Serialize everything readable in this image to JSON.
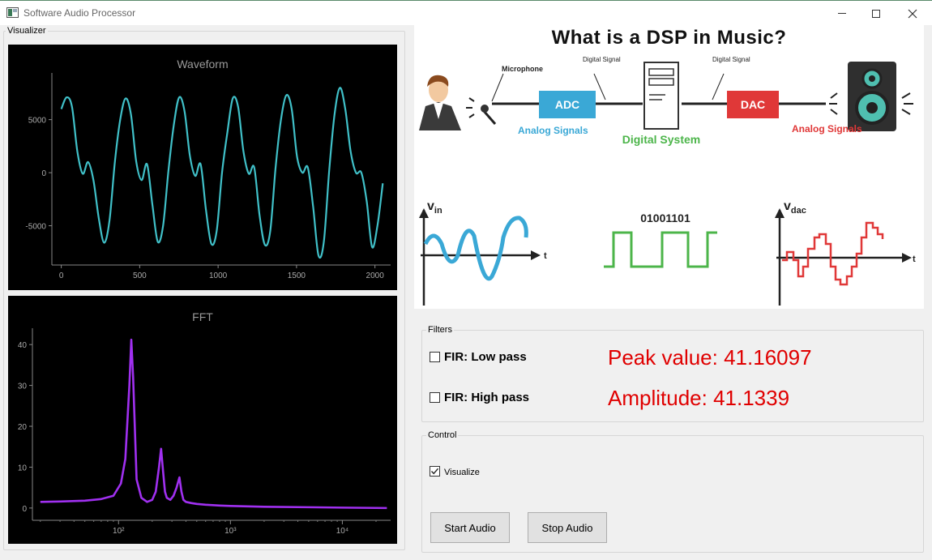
{
  "window": {
    "title": "Software Audio Processor",
    "minimize_icon": "minimize-icon",
    "maximize_icon": "maximize-icon",
    "close_icon": "close-icon"
  },
  "visualizer": {
    "title": "Visualizer",
    "waveform": {
      "title": "Waveform",
      "y_ticks": [
        "5000",
        "0",
        "-5000"
      ],
      "x_ticks": [
        "0",
        "500",
        "1000",
        "1500",
        "2000"
      ],
      "line_color": "#40c0c8"
    },
    "fft": {
      "title": "FFT",
      "y_ticks": [
        "40",
        "30",
        "20",
        "10",
        "0"
      ],
      "x_ticks": [
        "10²",
        "10³",
        "10⁴"
      ],
      "line_color": "#a030f0"
    }
  },
  "dsp_image": {
    "heading": "What is a DSP in Music?",
    "labels": {
      "microphone": "Microphone",
      "digital_signal_1": "Digital Signal",
      "digital_signal_2": "Digital Signal",
      "adc": "ADC",
      "dac": "DAC",
      "analog_signals_1": "Analog Signals",
      "analog_signals_2": "Analog Signals",
      "digital_system": "Digital System",
      "vin": "v",
      "vin_sub": "in",
      "vdac": "v",
      "vdac_sub": "dac",
      "binary": "01001101",
      "t1": "t",
      "t2": "t"
    }
  },
  "filters": {
    "title": "Filters",
    "low_pass_label": "FIR: Low pass",
    "low_pass_checked": false,
    "high_pass_label": "FIR: High pass",
    "high_pass_checked": false,
    "peak_text": "Peak value: 41.16097",
    "amplitude_text": "Amplitude: 41.1339",
    "stat_color": "#e00000"
  },
  "control": {
    "title": "Control",
    "visualize_label": "Visualize",
    "visualize_checked": true,
    "start_label": "Start Audio",
    "stop_label": "Stop Audio"
  },
  "chart_data": [
    {
      "type": "line",
      "title": "Waveform",
      "xlim": [
        -60,
        2100
      ],
      "ylim": [
        -8700,
        9400
      ],
      "x_ticks": [
        0,
        500,
        1000,
        1500,
        2000
      ],
      "y_ticks": [
        5000,
        0,
        -5000
      ],
      "grid": false,
      "series": [
        {
          "values": [
            6000,
            7100,
            6200,
            2000,
            -100,
            1000,
            -700,
            -4300,
            -6600,
            -4500,
            1000,
            5000,
            7000,
            5500,
            1000,
            -700,
            800,
            -3000,
            -6500,
            -5000,
            200,
            4500,
            7100,
            5800,
            1600,
            -300,
            800,
            -3500,
            -6700,
            -5500,
            0,
            3800,
            7000,
            6200,
            2000,
            -100,
            500,
            -4000,
            -6800,
            -5500,
            500,
            5000,
            7300,
            6000,
            1500,
            0,
            500,
            -3200,
            -7800,
            -6500,
            200,
            5500,
            8000,
            6000,
            2000,
            0,
            0,
            -2700,
            -7000,
            -5000,
            -1000
          ],
          "x_start": 0,
          "x_end": 2050
        }
      ]
    },
    {
      "type": "line",
      "title": "FFT",
      "x_scale": "log",
      "xlim": [
        17,
        27000
      ],
      "ylim": [
        -3,
        44
      ],
      "x_ticks": [
        100,
        1000,
        10000
      ],
      "y_ticks": [
        40,
        30,
        20,
        10,
        0
      ],
      "grid": false,
      "series": [
        {
          "x": [
            20,
            30,
            50,
            70,
            90,
            105,
            115,
            125,
            130,
            135,
            145,
            160,
            180,
            200,
            215,
            230,
            240,
            250,
            260,
            270,
            290,
            310,
            330,
            350,
            365,
            380,
            400,
            450,
            500,
            600,
            800,
            1000,
            2000,
            5000,
            10000,
            25000
          ],
          "y": [
            1.5,
            1.6,
            1.8,
            2.2,
            3.0,
            6.0,
            12.0,
            30.0,
            41.2,
            32.0,
            7.0,
            2.5,
            1.5,
            2.0,
            4.0,
            10.0,
            14.5,
            9.0,
            4.0,
            2.5,
            2.0,
            3.0,
            5.0,
            7.5,
            4.0,
            2.0,
            1.5,
            1.2,
            1.0,
            0.8,
            0.6,
            0.5,
            0.3,
            0.2,
            0.1,
            0.0
          ]
        }
      ]
    }
  ]
}
